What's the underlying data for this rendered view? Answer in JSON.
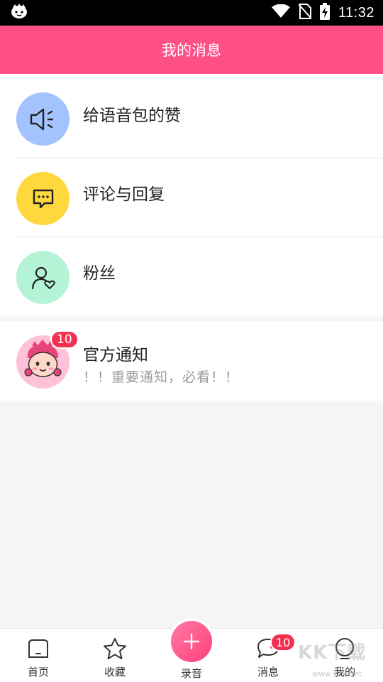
{
  "status_bar": {
    "time": "11:32",
    "icons": [
      "app-logo-icon",
      "wifi-icon",
      "no-sim-icon",
      "battery-charging-icon"
    ]
  },
  "header": {
    "title": "我的消息"
  },
  "menu": {
    "items": [
      {
        "label": "给语音包的赞",
        "icon": "speaker-icon",
        "color": "#a3c3ff"
      },
      {
        "label": "评论与回复",
        "icon": "comment-icon",
        "color": "#ffd83d"
      },
      {
        "label": "粉丝",
        "icon": "fan-user-icon",
        "color": "#b4f3d6"
      }
    ]
  },
  "notice": {
    "title": "官方通知",
    "subtitle": "！！重要通知，必看！！",
    "badge": "10",
    "avatar_color": "#ffc1d8"
  },
  "bottom_nav": {
    "items": [
      {
        "label": "首页",
        "icon": "home-icon"
      },
      {
        "label": "收藏",
        "icon": "star-icon"
      },
      {
        "label": "录音",
        "icon": "plus-icon"
      },
      {
        "label": "消息",
        "icon": "message-icon",
        "badge": "10"
      },
      {
        "label": "我的",
        "icon": "profile-icon"
      }
    ]
  },
  "watermark": {
    "main": "KK下载",
    "sub": "www.kkx.net"
  },
  "colors": {
    "accent": "#ff4f87",
    "badge": "#f3304f"
  }
}
